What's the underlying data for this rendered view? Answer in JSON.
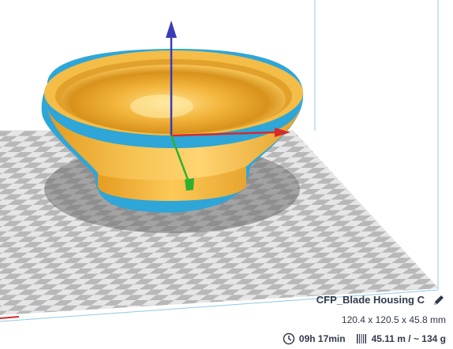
{
  "object": {
    "name": "CFP_Blade Housing C",
    "dimensions": "120.4 x 120.5 x 45.8 mm",
    "print_time": "09h 17min",
    "material": "45.11 m / ~ 134 g"
  },
  "colors": {
    "background": "#ffffff",
    "build_plate_dark": "#b5b5b5",
    "build_plate_light": "#e6e6e6",
    "outline": "#2ea6d8",
    "model": "#f3b536",
    "axis_x": "#d62a2a",
    "axis_y": "#2fb02f",
    "axis_z": "#3b3bb8"
  },
  "icons": {
    "edit": "pencil-icon",
    "time": "clock-icon",
    "material": "spool-icon"
  }
}
